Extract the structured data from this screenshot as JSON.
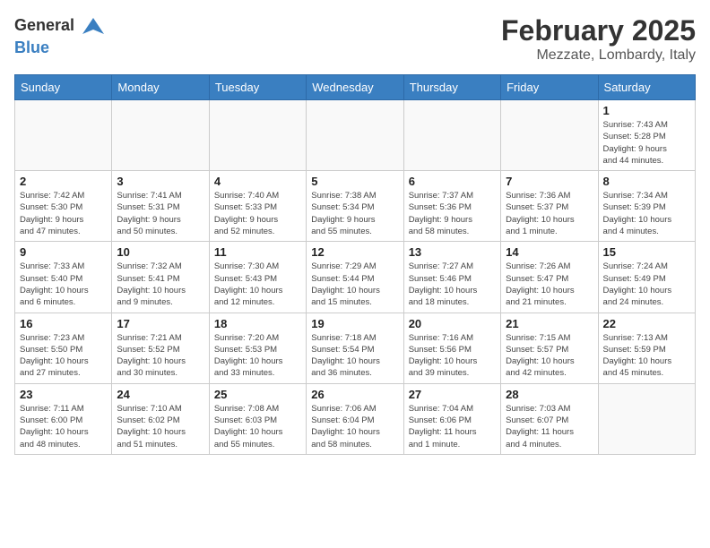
{
  "header": {
    "logo_general": "General",
    "logo_blue": "Blue",
    "month": "February 2025",
    "location": "Mezzate, Lombardy, Italy"
  },
  "weekdays": [
    "Sunday",
    "Monday",
    "Tuesday",
    "Wednesday",
    "Thursday",
    "Friday",
    "Saturday"
  ],
  "weeks": [
    [
      {
        "day": "",
        "detail": ""
      },
      {
        "day": "",
        "detail": ""
      },
      {
        "day": "",
        "detail": ""
      },
      {
        "day": "",
        "detail": ""
      },
      {
        "day": "",
        "detail": ""
      },
      {
        "day": "",
        "detail": ""
      },
      {
        "day": "1",
        "detail": "Sunrise: 7:43 AM\nSunset: 5:28 PM\nDaylight: 9 hours\nand 44 minutes."
      }
    ],
    [
      {
        "day": "2",
        "detail": "Sunrise: 7:42 AM\nSunset: 5:30 PM\nDaylight: 9 hours\nand 47 minutes."
      },
      {
        "day": "3",
        "detail": "Sunrise: 7:41 AM\nSunset: 5:31 PM\nDaylight: 9 hours\nand 50 minutes."
      },
      {
        "day": "4",
        "detail": "Sunrise: 7:40 AM\nSunset: 5:33 PM\nDaylight: 9 hours\nand 52 minutes."
      },
      {
        "day": "5",
        "detail": "Sunrise: 7:38 AM\nSunset: 5:34 PM\nDaylight: 9 hours\nand 55 minutes."
      },
      {
        "day": "6",
        "detail": "Sunrise: 7:37 AM\nSunset: 5:36 PM\nDaylight: 9 hours\nand 58 minutes."
      },
      {
        "day": "7",
        "detail": "Sunrise: 7:36 AM\nSunset: 5:37 PM\nDaylight: 10 hours\nand 1 minute."
      },
      {
        "day": "8",
        "detail": "Sunrise: 7:34 AM\nSunset: 5:39 PM\nDaylight: 10 hours\nand 4 minutes."
      }
    ],
    [
      {
        "day": "9",
        "detail": "Sunrise: 7:33 AM\nSunset: 5:40 PM\nDaylight: 10 hours\nand 6 minutes."
      },
      {
        "day": "10",
        "detail": "Sunrise: 7:32 AM\nSunset: 5:41 PM\nDaylight: 10 hours\nand 9 minutes."
      },
      {
        "day": "11",
        "detail": "Sunrise: 7:30 AM\nSunset: 5:43 PM\nDaylight: 10 hours\nand 12 minutes."
      },
      {
        "day": "12",
        "detail": "Sunrise: 7:29 AM\nSunset: 5:44 PM\nDaylight: 10 hours\nand 15 minutes."
      },
      {
        "day": "13",
        "detail": "Sunrise: 7:27 AM\nSunset: 5:46 PM\nDaylight: 10 hours\nand 18 minutes."
      },
      {
        "day": "14",
        "detail": "Sunrise: 7:26 AM\nSunset: 5:47 PM\nDaylight: 10 hours\nand 21 minutes."
      },
      {
        "day": "15",
        "detail": "Sunrise: 7:24 AM\nSunset: 5:49 PM\nDaylight: 10 hours\nand 24 minutes."
      }
    ],
    [
      {
        "day": "16",
        "detail": "Sunrise: 7:23 AM\nSunset: 5:50 PM\nDaylight: 10 hours\nand 27 minutes."
      },
      {
        "day": "17",
        "detail": "Sunrise: 7:21 AM\nSunset: 5:52 PM\nDaylight: 10 hours\nand 30 minutes."
      },
      {
        "day": "18",
        "detail": "Sunrise: 7:20 AM\nSunset: 5:53 PM\nDaylight: 10 hours\nand 33 minutes."
      },
      {
        "day": "19",
        "detail": "Sunrise: 7:18 AM\nSunset: 5:54 PM\nDaylight: 10 hours\nand 36 minutes."
      },
      {
        "day": "20",
        "detail": "Sunrise: 7:16 AM\nSunset: 5:56 PM\nDaylight: 10 hours\nand 39 minutes."
      },
      {
        "day": "21",
        "detail": "Sunrise: 7:15 AM\nSunset: 5:57 PM\nDaylight: 10 hours\nand 42 minutes."
      },
      {
        "day": "22",
        "detail": "Sunrise: 7:13 AM\nSunset: 5:59 PM\nDaylight: 10 hours\nand 45 minutes."
      }
    ],
    [
      {
        "day": "23",
        "detail": "Sunrise: 7:11 AM\nSunset: 6:00 PM\nDaylight: 10 hours\nand 48 minutes."
      },
      {
        "day": "24",
        "detail": "Sunrise: 7:10 AM\nSunset: 6:02 PM\nDaylight: 10 hours\nand 51 minutes."
      },
      {
        "day": "25",
        "detail": "Sunrise: 7:08 AM\nSunset: 6:03 PM\nDaylight: 10 hours\nand 55 minutes."
      },
      {
        "day": "26",
        "detail": "Sunrise: 7:06 AM\nSunset: 6:04 PM\nDaylight: 10 hours\nand 58 minutes."
      },
      {
        "day": "27",
        "detail": "Sunrise: 7:04 AM\nSunset: 6:06 PM\nDaylight: 11 hours\nand 1 minute."
      },
      {
        "day": "28",
        "detail": "Sunrise: 7:03 AM\nSunset: 6:07 PM\nDaylight: 11 hours\nand 4 minutes."
      },
      {
        "day": "",
        "detail": ""
      }
    ]
  ]
}
